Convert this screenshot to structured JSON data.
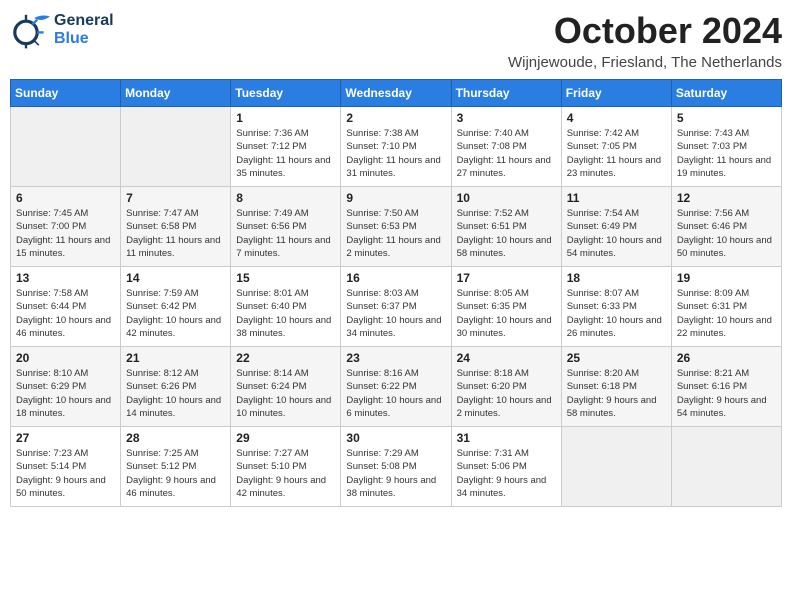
{
  "logo": {
    "general": "General",
    "blue": "Blue"
  },
  "title": "October 2024",
  "location": "Wijnjewoude, Friesland, The Netherlands",
  "days_of_week": [
    "Sunday",
    "Monday",
    "Tuesday",
    "Wednesday",
    "Thursday",
    "Friday",
    "Saturday"
  ],
  "weeks": [
    [
      {
        "day": "",
        "info": ""
      },
      {
        "day": "",
        "info": ""
      },
      {
        "day": "1",
        "info": "Sunrise: 7:36 AM\nSunset: 7:12 PM\nDaylight: 11 hours and 35 minutes."
      },
      {
        "day": "2",
        "info": "Sunrise: 7:38 AM\nSunset: 7:10 PM\nDaylight: 11 hours and 31 minutes."
      },
      {
        "day": "3",
        "info": "Sunrise: 7:40 AM\nSunset: 7:08 PM\nDaylight: 11 hours and 27 minutes."
      },
      {
        "day": "4",
        "info": "Sunrise: 7:42 AM\nSunset: 7:05 PM\nDaylight: 11 hours and 23 minutes."
      },
      {
        "day": "5",
        "info": "Sunrise: 7:43 AM\nSunset: 7:03 PM\nDaylight: 11 hours and 19 minutes."
      }
    ],
    [
      {
        "day": "6",
        "info": "Sunrise: 7:45 AM\nSunset: 7:00 PM\nDaylight: 11 hours and 15 minutes."
      },
      {
        "day": "7",
        "info": "Sunrise: 7:47 AM\nSunset: 6:58 PM\nDaylight: 11 hours and 11 minutes."
      },
      {
        "day": "8",
        "info": "Sunrise: 7:49 AM\nSunset: 6:56 PM\nDaylight: 11 hours and 7 minutes."
      },
      {
        "day": "9",
        "info": "Sunrise: 7:50 AM\nSunset: 6:53 PM\nDaylight: 11 hours and 2 minutes."
      },
      {
        "day": "10",
        "info": "Sunrise: 7:52 AM\nSunset: 6:51 PM\nDaylight: 10 hours and 58 minutes."
      },
      {
        "day": "11",
        "info": "Sunrise: 7:54 AM\nSunset: 6:49 PM\nDaylight: 10 hours and 54 minutes."
      },
      {
        "day": "12",
        "info": "Sunrise: 7:56 AM\nSunset: 6:46 PM\nDaylight: 10 hours and 50 minutes."
      }
    ],
    [
      {
        "day": "13",
        "info": "Sunrise: 7:58 AM\nSunset: 6:44 PM\nDaylight: 10 hours and 46 minutes."
      },
      {
        "day": "14",
        "info": "Sunrise: 7:59 AM\nSunset: 6:42 PM\nDaylight: 10 hours and 42 minutes."
      },
      {
        "day": "15",
        "info": "Sunrise: 8:01 AM\nSunset: 6:40 PM\nDaylight: 10 hours and 38 minutes."
      },
      {
        "day": "16",
        "info": "Sunrise: 8:03 AM\nSunset: 6:37 PM\nDaylight: 10 hours and 34 minutes."
      },
      {
        "day": "17",
        "info": "Sunrise: 8:05 AM\nSunset: 6:35 PM\nDaylight: 10 hours and 30 minutes."
      },
      {
        "day": "18",
        "info": "Sunrise: 8:07 AM\nSunset: 6:33 PM\nDaylight: 10 hours and 26 minutes."
      },
      {
        "day": "19",
        "info": "Sunrise: 8:09 AM\nSunset: 6:31 PM\nDaylight: 10 hours and 22 minutes."
      }
    ],
    [
      {
        "day": "20",
        "info": "Sunrise: 8:10 AM\nSunset: 6:29 PM\nDaylight: 10 hours and 18 minutes."
      },
      {
        "day": "21",
        "info": "Sunrise: 8:12 AM\nSunset: 6:26 PM\nDaylight: 10 hours and 14 minutes."
      },
      {
        "day": "22",
        "info": "Sunrise: 8:14 AM\nSunset: 6:24 PM\nDaylight: 10 hours and 10 minutes."
      },
      {
        "day": "23",
        "info": "Sunrise: 8:16 AM\nSunset: 6:22 PM\nDaylight: 10 hours and 6 minutes."
      },
      {
        "day": "24",
        "info": "Sunrise: 8:18 AM\nSunset: 6:20 PM\nDaylight: 10 hours and 2 minutes."
      },
      {
        "day": "25",
        "info": "Sunrise: 8:20 AM\nSunset: 6:18 PM\nDaylight: 9 hours and 58 minutes."
      },
      {
        "day": "26",
        "info": "Sunrise: 8:21 AM\nSunset: 6:16 PM\nDaylight: 9 hours and 54 minutes."
      }
    ],
    [
      {
        "day": "27",
        "info": "Sunrise: 7:23 AM\nSunset: 5:14 PM\nDaylight: 9 hours and 50 minutes."
      },
      {
        "day": "28",
        "info": "Sunrise: 7:25 AM\nSunset: 5:12 PM\nDaylight: 9 hours and 46 minutes."
      },
      {
        "day": "29",
        "info": "Sunrise: 7:27 AM\nSunset: 5:10 PM\nDaylight: 9 hours and 42 minutes."
      },
      {
        "day": "30",
        "info": "Sunrise: 7:29 AM\nSunset: 5:08 PM\nDaylight: 9 hours and 38 minutes."
      },
      {
        "day": "31",
        "info": "Sunrise: 7:31 AM\nSunset: 5:06 PM\nDaylight: 9 hours and 34 minutes."
      },
      {
        "day": "",
        "info": ""
      },
      {
        "day": "",
        "info": ""
      }
    ]
  ]
}
